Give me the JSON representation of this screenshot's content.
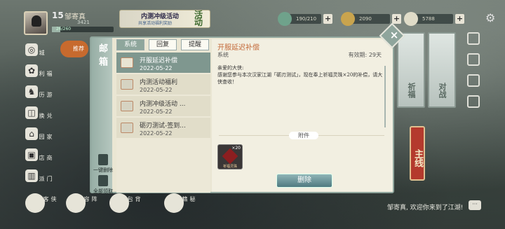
{
  "player": {
    "level": "15",
    "name": "邹寄真",
    "score": "3421",
    "exp": "26/260",
    "exp_ratio": 0.14
  },
  "event": {
    "title": "内测冲级活动",
    "subtitle": "共享活动福利奖励",
    "tag": "活动"
  },
  "resources": [
    {
      "value": "190/210",
      "color": "#6fa28b"
    },
    {
      "value": "2090",
      "color": "#c9a44e"
    },
    {
      "value": "5788",
      "color": "#e0dcc8"
    }
  ],
  "left_menu": [
    {
      "icon": "city-icon",
      "label": "城",
      "glyph": "◎"
    },
    {
      "icon": "welfare-icon",
      "label": "福利",
      "glyph": "✿"
    },
    {
      "icon": "travel-icon",
      "label": "游历",
      "glyph": "♞"
    },
    {
      "icon": "exchange-icon",
      "label": "兑换",
      "glyph": "◫"
    },
    {
      "icon": "home-icon",
      "label": "家园",
      "glyph": "⌂"
    },
    {
      "icon": "shop-icon",
      "label": "商店",
      "glyph": "▣"
    },
    {
      "icon": "sect-icon",
      "label": "门派",
      "glyph": "▥"
    }
  ],
  "recommend": "推荐",
  "mail": {
    "title": "邮箱",
    "tabs": [
      "系统",
      "回复",
      "提醒"
    ],
    "active_tab": 0,
    "one_key_delete": "一键删除",
    "receive_all": "全部领取",
    "items": [
      {
        "title": "开服延迟补偿",
        "date": "2022-05-22",
        "active": true
      },
      {
        "title": "内测活动福利",
        "date": "2022-05-22",
        "active": false
      },
      {
        "title": "内测冲级活动 ...",
        "date": "2022-05-22",
        "active": false
      },
      {
        "title": "砺刃测试-签到...",
        "date": "2022-05-22",
        "active": false
      }
    ],
    "detail": {
      "title": "开服延迟补偿",
      "from": "系统",
      "valid_label": "有效期:",
      "valid_value": "29天",
      "greeting": "亲爱的大侠:",
      "body": "感谢您参与本次汉家江湖「砺刃测试」，现在奉上祈福灵珠×20的补偿，请大侠查收！",
      "attachment_label": "附件",
      "attachment": {
        "name": "祈福灵珠",
        "count": "×20"
      },
      "delete_label": "删除"
    }
  },
  "right_banners": [
    "祈福",
    "对战"
  ],
  "mainline": "主线",
  "bottom_icons": [
    {
      "label": "侠客"
    },
    {
      "label": "阵容"
    },
    {
      "label": "背包"
    },
    {
      "label": "秘籍"
    }
  ],
  "welcome": "邹寄真, 欢迎你来到了江湖!",
  "chat_icon": "···"
}
